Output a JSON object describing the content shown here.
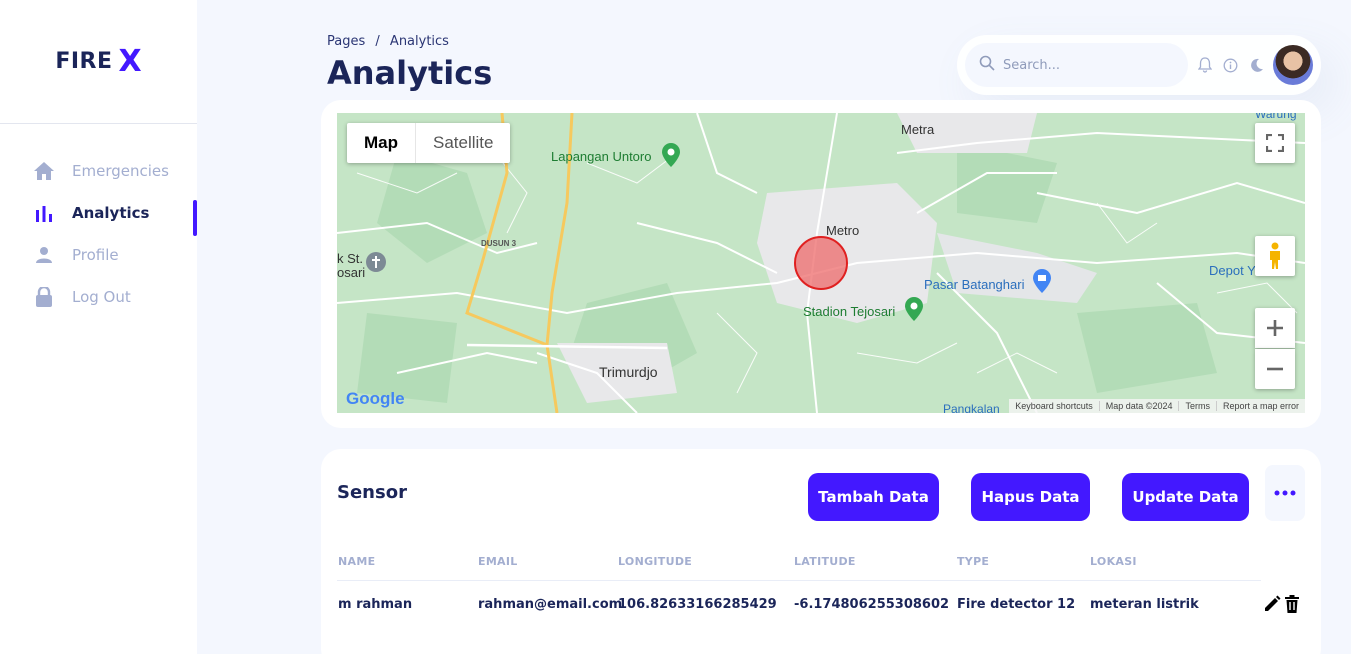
{
  "brand": {
    "word1": "FIRE",
    "word2": "X"
  },
  "sidebar": {
    "items": [
      {
        "label": "Emergencies",
        "icon": "home-icon"
      },
      {
        "label": "Analytics",
        "icon": "bar-chart-icon",
        "active": true
      },
      {
        "label": "Profile",
        "icon": "person-icon"
      },
      {
        "label": "Log Out",
        "icon": "lock-icon"
      }
    ]
  },
  "header": {
    "breadcrumb_root": "Pages",
    "breadcrumb_sep": "/",
    "breadcrumb_current": "Analytics",
    "title": "Analytics",
    "search_placeholder": "Search..."
  },
  "map": {
    "type_map": "Map",
    "type_satellite": "Satellite",
    "labels": {
      "metra": "Metra",
      "lapangan": "Lapangan Untoro",
      "metro": "Metro",
      "dusun": "DUSUN 3",
      "pasar": "Pasar Batanghari",
      "depot": "Depot Y",
      "stadion": "Stadion Tejosari",
      "trimurdjo": "Trimurdjo",
      "pangkalan": "Pangkalan",
      "st": "k St.",
      "sari": "osari",
      "warung": "Warung"
    },
    "google": "Google",
    "attribution": [
      "Keyboard shortcuts",
      "Map data ©2024",
      "Terms",
      "Report a map error"
    ],
    "colors": {
      "land": "#c5e5c6",
      "urban": "#e8e8ea",
      "road": "#ffffff",
      "highway": "#f6c95e",
      "circle": "#ee5a5a"
    }
  },
  "sensor": {
    "title": "Sensor",
    "buttons": {
      "add": "Tambah Data",
      "delete": "Hapus Data",
      "update": "Update Data"
    },
    "columns": [
      "NAME",
      "EMAIL",
      "LONGITUDE",
      "LATITUDE",
      "TYPE",
      "LOKASI"
    ],
    "rows": [
      {
        "name": "m rahman",
        "email": "rahman@email.com",
        "longitude": "106.82633166285429",
        "latitude": "-6.174806255308602",
        "type": "Fire detector 12",
        "lokasi": "meteran listrik"
      }
    ]
  },
  "colors": {
    "accent": "#4318ff",
    "text": "#1b2559",
    "muted": "#a3aed0",
    "bg": "#f4f7fe"
  }
}
